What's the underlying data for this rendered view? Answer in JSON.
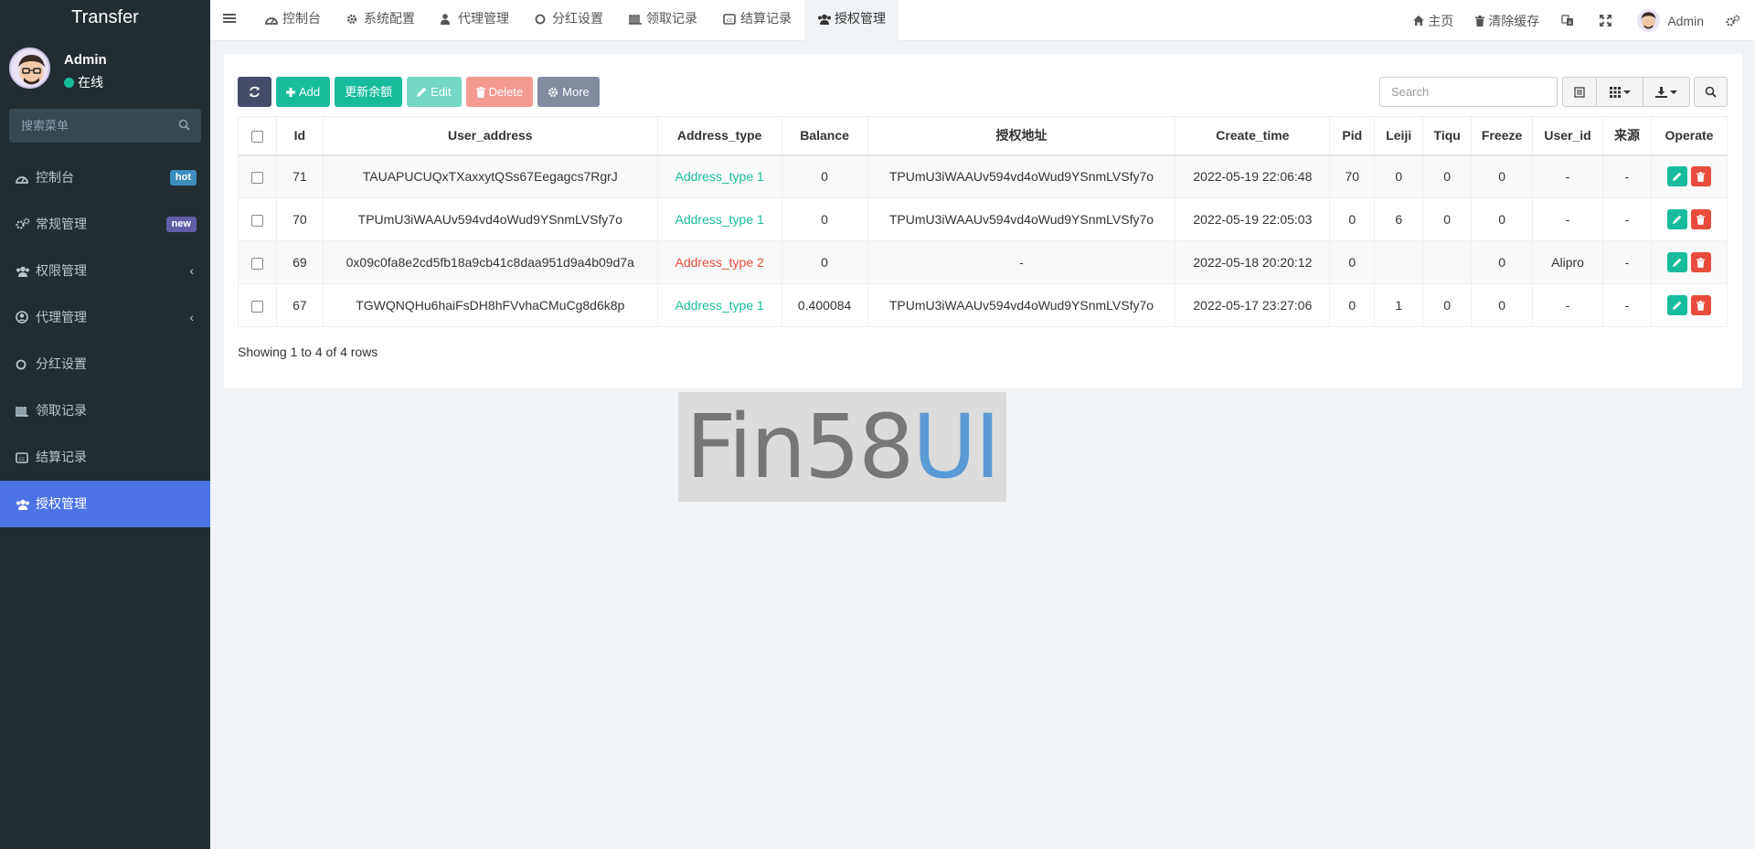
{
  "sidebar": {
    "brand": "Transfer",
    "user": {
      "name": "Admin",
      "status": "在线"
    },
    "search_placeholder": "搜索菜单",
    "items": [
      {
        "label": "控制台",
        "badge": "hot"
      },
      {
        "label": "常规管理",
        "badge": "new"
      },
      {
        "label": "权限管理"
      },
      {
        "label": "代理管理"
      },
      {
        "label": "分红设置"
      },
      {
        "label": "领取记录"
      },
      {
        "label": "结算记录"
      },
      {
        "label": "授权管理"
      }
    ]
  },
  "topbar": {
    "tabs": [
      "控制台",
      "系统配置",
      "代理管理",
      "分红设置",
      "领取记录",
      "结算记录",
      "授权管理"
    ],
    "right": {
      "home": "主页",
      "clear_cache": "清除缓存",
      "user": "Admin"
    }
  },
  "toolbar": {
    "add": "Add",
    "update_balance": "更新余额",
    "edit": "Edit",
    "delete": "Delete",
    "more": "More",
    "search_placeholder": "Search"
  },
  "table": {
    "columns": [
      "Id",
      "User_address",
      "Address_type",
      "Balance",
      "授权地址",
      "Create_time",
      "Pid",
      "Leiji",
      "Tiqu",
      "Freeze",
      "User_id",
      "来源",
      "Operate"
    ],
    "rows": [
      {
        "id": "71",
        "user_address": "TAUAPUCUQxTXaxxytQSs67Eegagcs7RgrJ",
        "address_type": "Address_type 1",
        "balance": "0",
        "auth_address": "TPUmU3iWAAUv594vd4oWud9YSnmLVSfy7o",
        "create_time": "2022-05-19 22:06:48",
        "pid": "70",
        "leiji": "0",
        "tiqu": "0",
        "freeze": "0",
        "user_id": "-",
        "source": "-"
      },
      {
        "id": "70",
        "user_address": "TPUmU3iWAAUv594vd4oWud9YSnmLVSfy7o",
        "address_type": "Address_type 1",
        "balance": "0",
        "auth_address": "TPUmU3iWAAUv594vd4oWud9YSnmLVSfy7o",
        "create_time": "2022-05-19 22:05:03",
        "pid": "0",
        "leiji": "6",
        "tiqu": "0",
        "freeze": "0",
        "user_id": "-",
        "source": "-"
      },
      {
        "id": "69",
        "user_address": "0x09c0fa8e2cd5fb18a9cb41c8daa951d9a4b09d7a",
        "address_type": "Address_type 2",
        "balance": "0",
        "auth_address": "-",
        "create_time": "2022-05-18 20:20:12",
        "pid": "0",
        "leiji": "",
        "tiqu": "",
        "freeze": "0",
        "user_id": "Alipro",
        "source": "-"
      },
      {
        "id": "67",
        "user_address": "TGWQNQHu6haiFsDH8hFVvhaCMuCg8d6k8p",
        "address_type": "Address_type 1",
        "balance": "0.400084",
        "auth_address": "TPUmU3iWAAUv594vd4oWud9YSnmLVSfy7o",
        "create_time": "2022-05-17 23:27:06",
        "pid": "0",
        "leiji": "1",
        "tiqu": "0",
        "freeze": "0",
        "user_id": "-",
        "source": "-"
      }
    ],
    "footer": "Showing 1 to 4 of 4 rows"
  },
  "watermark": {
    "part1": "Fin58",
    "part2": "UI"
  }
}
